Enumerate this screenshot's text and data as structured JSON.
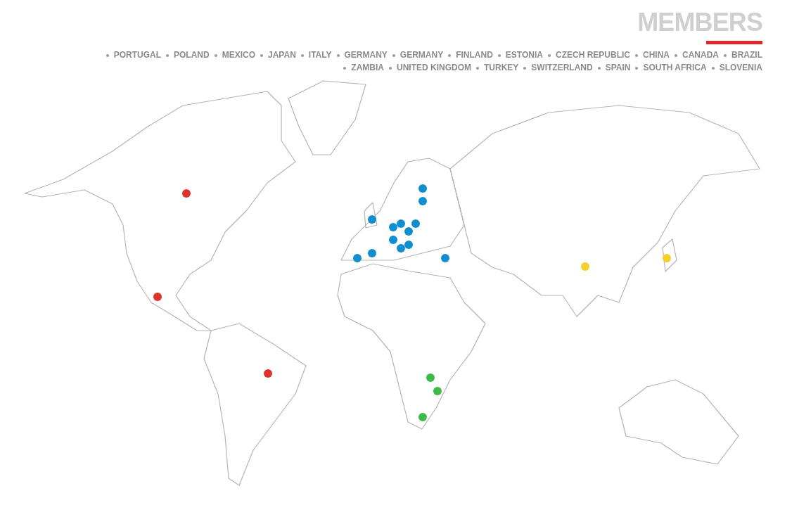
{
  "title": "MEMBERS",
  "countries": [
    [
      "PORTUGAL",
      "POLAND",
      "MEXICO",
      "JAPAN",
      "ITALY",
      "GERMANY",
      "GERMANY",
      "FINLAND",
      "ESTONIA",
      "CZECH REPUBLIC",
      "CHINA",
      "CANADA",
      "BRAZIL"
    ],
    [
      "ZAMBIA",
      "UNITED KINGDOM",
      "TURKEY",
      "SWITZERLAND",
      "SPAIN",
      "SOUTH AFRICA",
      "SLOVENIA"
    ]
  ],
  "pins": [
    {
      "color": "#e0312b"
    },
    {
      "color": "#e0312b"
    },
    {
      "color": "#e0312b"
    },
    {
      "color": "#0f8fd0"
    },
    {
      "color": "#0f8fd0"
    },
    {
      "color": "#0f8fd0"
    },
    {
      "color": "#0f8fd0"
    },
    {
      "color": "#0f8fd0"
    },
    {
      "color": "#0f8fd0"
    },
    {
      "color": "#0f8fd0"
    },
    {
      "color": "#0f8fd0"
    },
    {
      "color": "#0f8fd0"
    },
    {
      "color": "#0f8fd0"
    },
    {
      "color": "#0f8fd0"
    },
    {
      "color": "#0f8fd0"
    },
    {
      "color": "#0f8fd0"
    },
    {
      "color": "#f5cf2a"
    },
    {
      "color": "#f5cf2a"
    },
    {
      "color": "#3dbb4a"
    },
    {
      "color": "#3dbb4a"
    },
    {
      "color": "#3dbb4a"
    }
  ]
}
